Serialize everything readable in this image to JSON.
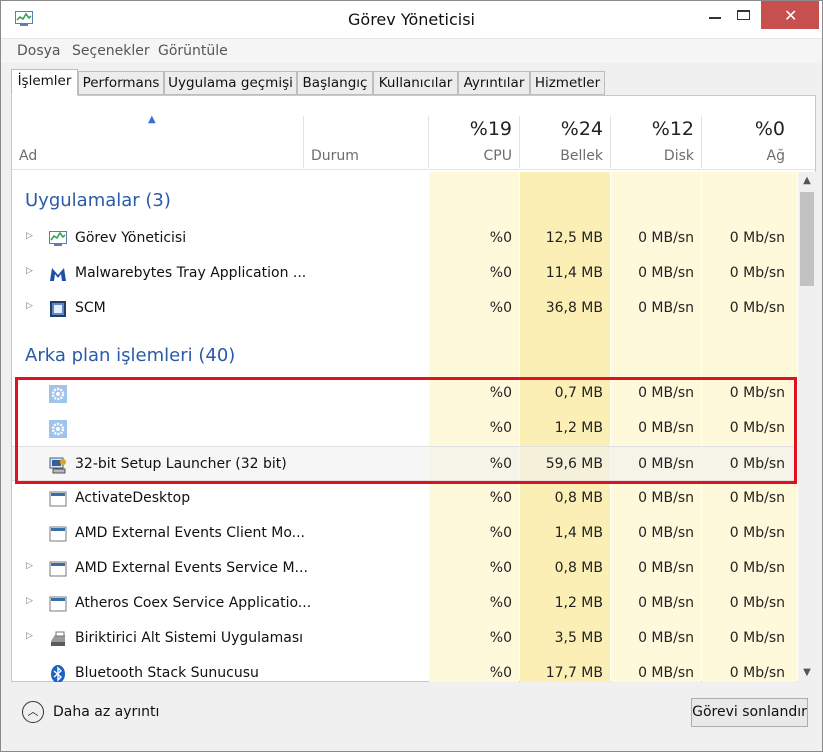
{
  "window": {
    "title": "Görev Yöneticisi",
    "close_glyph": "✕"
  },
  "menu": [
    "Dosya",
    "Seçenekler",
    "Görüntüle"
  ],
  "tabs": [
    "İşlemler",
    "Performans",
    "Uygulama geçmişi",
    "Başlangıç",
    "Kullanıcılar",
    "Ayrıntılar",
    "Hizmetler"
  ],
  "columns": {
    "name": "Ad",
    "status": "Durum",
    "cpu": {
      "pct": "%19",
      "label": "CPU"
    },
    "mem": {
      "pct": "%24",
      "label": "Bellek"
    },
    "disk": {
      "pct": "%12",
      "label": "Disk"
    },
    "net": {
      "pct": "%0",
      "label": "Ağ"
    }
  },
  "groups": {
    "apps": "Uygulamalar (3)",
    "background": "Arka plan işlemleri (40)"
  },
  "apps": [
    {
      "name": "Görev Yöneticisi",
      "icon": "taskmgr-icon",
      "cpu": "%0",
      "mem": "12,5 MB",
      "disk": "0 MB/sn",
      "net": "0 Mb/sn"
    },
    {
      "name": "Malwarebytes Tray Application ...",
      "icon": "malwarebytes-icon",
      "cpu": "%0",
      "mem": "11,4 MB",
      "disk": "0 MB/sn",
      "net": "0 Mb/sn"
    },
    {
      "name": "SCM",
      "icon": "scm-icon",
      "cpu": "%0",
      "mem": "36,8 MB",
      "disk": "0 MB/sn",
      "net": "0 Mb/sn"
    }
  ],
  "background": [
    {
      "name": "",
      "icon": "gear-icon",
      "cpu": "%0",
      "mem": "0,7 MB",
      "disk": "0 MB/sn",
      "net": "0 Mb/sn"
    },
    {
      "name": "",
      "icon": "gear-icon",
      "cpu": "%0",
      "mem": "1,2 MB",
      "disk": "0 MB/sn",
      "net": "0 Mb/sn"
    },
    {
      "name": "32-bit Setup Launcher (32 bit)",
      "icon": "setup-icon",
      "cpu": "%0",
      "mem": "59,6 MB",
      "disk": "0 MB/sn",
      "net": "0 Mb/sn"
    },
    {
      "name": "ActivateDesktop",
      "icon": "window-icon",
      "cpu": "%0",
      "mem": "0,8 MB",
      "disk": "0 MB/sn",
      "net": "0 Mb/sn"
    },
    {
      "name": "AMD External Events Client Mo...",
      "icon": "window-icon",
      "cpu": "%0",
      "mem": "1,4 MB",
      "disk": "0 MB/sn",
      "net": "0 Mb/sn"
    },
    {
      "name": "AMD External Events Service M...",
      "icon": "window-icon",
      "cpu": "%0",
      "mem": "0,8 MB",
      "disk": "0 MB/sn",
      "net": "0 Mb/sn"
    },
    {
      "name": "Atheros Coex Service Applicatio...",
      "icon": "window-icon",
      "cpu": "%0",
      "mem": "1,2 MB",
      "disk": "0 MB/sn",
      "net": "0 Mb/sn"
    },
    {
      "name": "Biriktirici Alt Sistemi Uygulaması",
      "icon": "printer-icon",
      "cpu": "%0",
      "mem": "3,5 MB",
      "disk": "0 MB/sn",
      "net": "0 Mb/sn"
    },
    {
      "name": "Bluetooth Stack Sunucusu",
      "icon": "bluetooth-icon",
      "cpu": "%0",
      "mem": "17,7 MB",
      "disk": "0 MB/sn",
      "net": "0 Mb/sn"
    }
  ],
  "footer": {
    "less_details": "Daha az ayrıntı",
    "end_task": "Görevi sonlandır"
  },
  "colors": {
    "accent": "#2a5aa8",
    "highlight_box": "#e0121f",
    "heat_light": "#fff9dc",
    "heat_mid": "#fbefb6"
  }
}
